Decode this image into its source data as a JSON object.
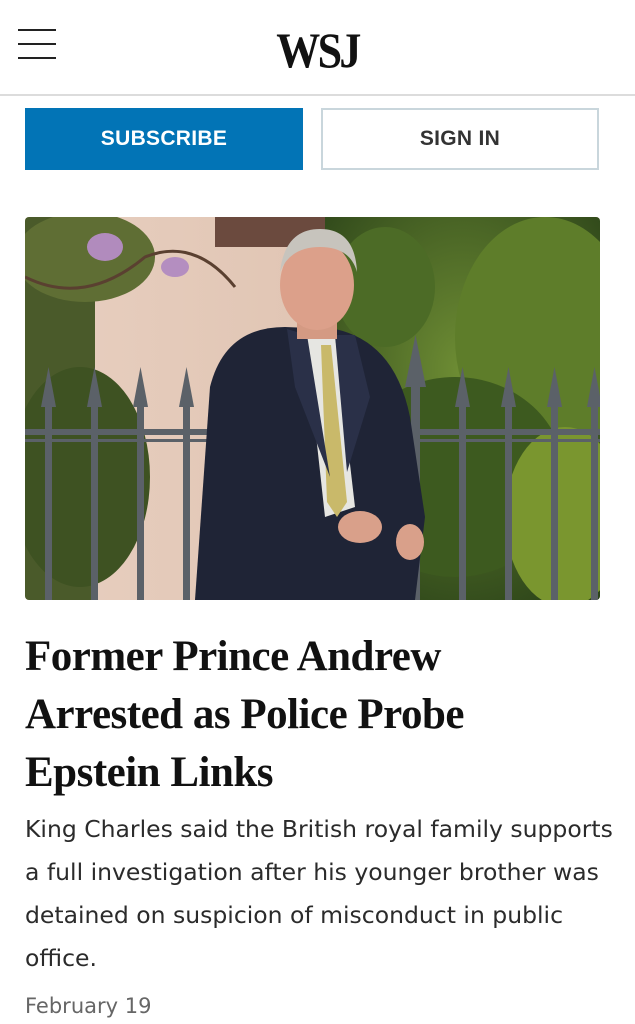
{
  "header": {
    "logo": "WSJ",
    "menu_icon": "hamburger-menu-icon"
  },
  "auth": {
    "subscribe_label": "SUBSCRIBE",
    "signin_label": "SIGN IN"
  },
  "colors": {
    "accent": "#0274b6",
    "text": "#111111",
    "muted": "#666666"
  },
  "article": {
    "headline": "Former Prince Andrew Arrested as Police Probe Epstein Links",
    "summary": "King Charles said the British royal family supports a full investigation after his younger brother was detained on suspicion of misconduct in public office.",
    "date": "February 19"
  }
}
